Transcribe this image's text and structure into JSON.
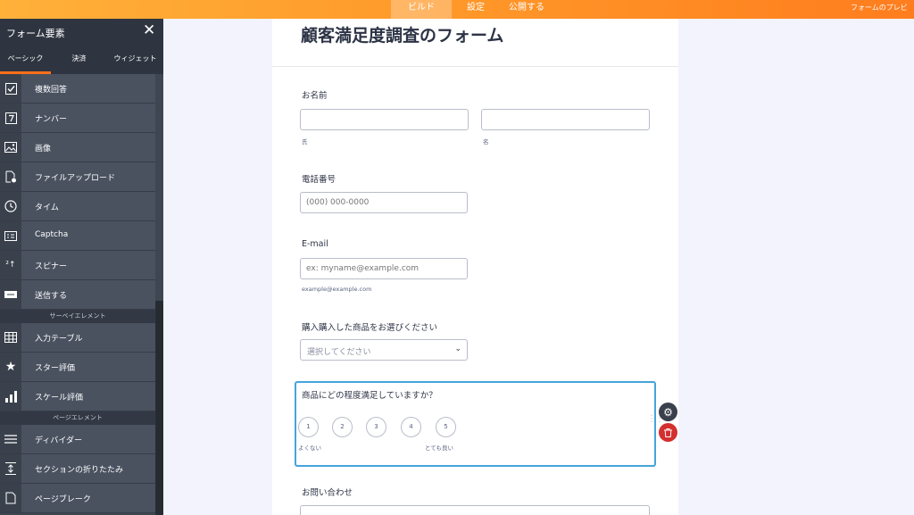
{
  "topbar": {
    "tabs": [
      {
        "label": "ビルド",
        "active": true
      },
      {
        "label": "設定",
        "active": false
      },
      {
        "label": "公開する",
        "active": false
      }
    ],
    "preview_label": "フォームのプレビ"
  },
  "sidebar": {
    "title": "フォーム要素",
    "tabs": [
      "ベーシック",
      "決済",
      "ウィジェット"
    ],
    "items": [
      {
        "label": "複数回答",
        "icon": "checkbox-icon"
      },
      {
        "label": "ナンバー",
        "icon": "number-icon"
      },
      {
        "label": "画像",
        "icon": "image-icon"
      },
      {
        "label": "ファイルアップロード",
        "icon": "file-upload-icon"
      },
      {
        "label": "タイム",
        "icon": "clock-icon"
      },
      {
        "label": "Captcha",
        "icon": "captcha-icon"
      },
      {
        "label": "スピナー",
        "icon": "spinner-icon"
      },
      {
        "label": "送信する",
        "icon": "submit-icon"
      }
    ],
    "section_survey": "サーベイエレメント",
    "survey_items": [
      {
        "label": "入力テーブル",
        "icon": "table-icon"
      },
      {
        "label": "スター評価",
        "icon": "star-icon"
      },
      {
        "label": "スケール評価",
        "icon": "bar-chart-icon"
      }
    ],
    "section_page": "ページエレメント",
    "page_items": [
      {
        "label": "ディバイダー",
        "icon": "divider-icon"
      },
      {
        "label": "セクションの折りたたみ",
        "icon": "collapse-icon"
      },
      {
        "label": "ページブレーク",
        "icon": "page-break-icon"
      }
    ]
  },
  "form": {
    "title": "顧客満足度調査のフォーム",
    "name": {
      "label": "お名前",
      "first_sub": "氏",
      "last_sub": "名",
      "first_value": "",
      "last_value": ""
    },
    "phone": {
      "label": "電話番号",
      "placeholder": "(000) 000-0000"
    },
    "email": {
      "label": "E-mail",
      "placeholder": "ex: myname@example.com",
      "sub": "example@example.com"
    },
    "product": {
      "label": "購入購入した商品をお選びください",
      "placeholder": "選択してください"
    },
    "satisfaction": {
      "label": "商品にどの程度満足していますか？",
      "options": [
        "1",
        "2",
        "3",
        "4",
        "5"
      ],
      "low_label": "よくない",
      "high_label": "とても良い"
    },
    "inquiry": {
      "label": "お問い合わせ"
    }
  },
  "colors": {
    "accent": "#ff7d1e",
    "focus": "#46a4dc",
    "delete": "#d3302f"
  }
}
